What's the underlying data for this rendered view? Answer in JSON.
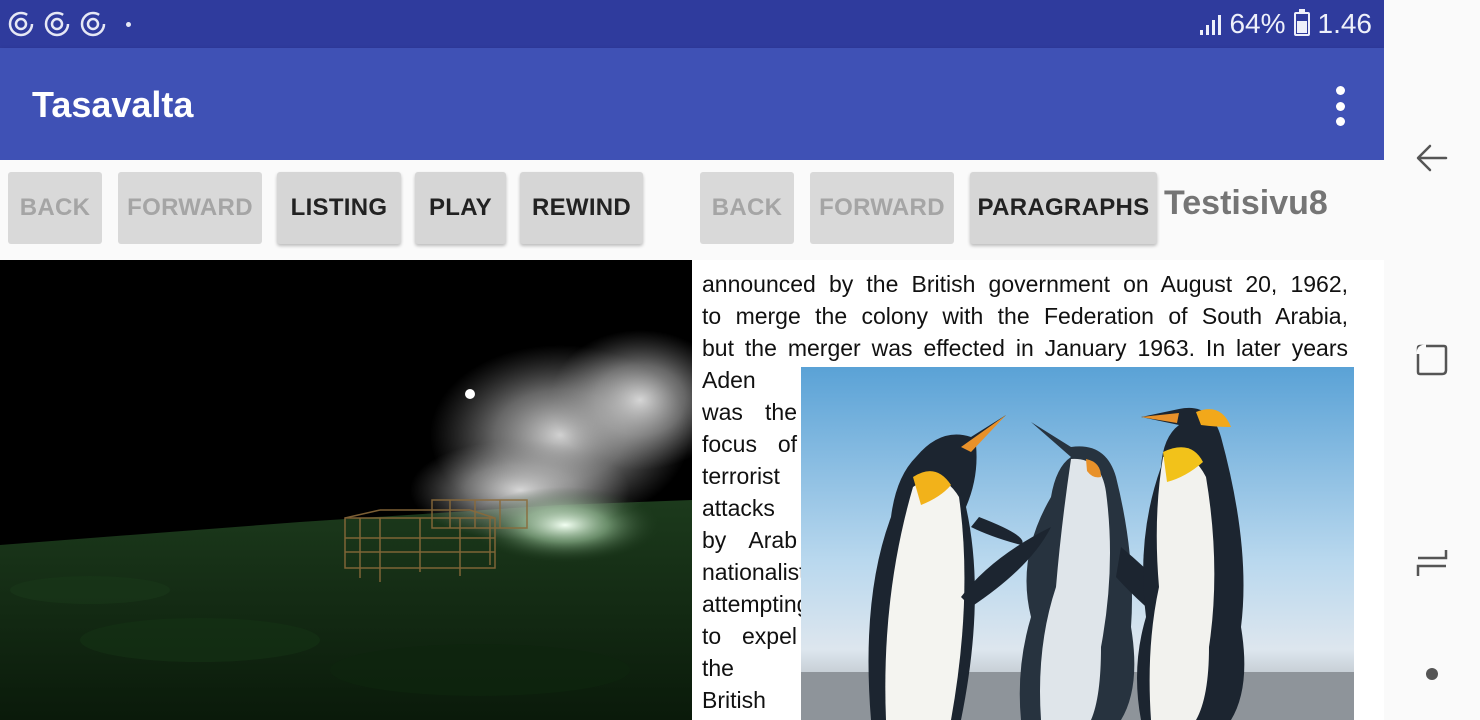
{
  "status_bar": {
    "notification_icons": [
      "sync-icon",
      "sync-icon",
      "sync-icon",
      "dot-icon"
    ],
    "battery_percent": "64%",
    "time": "1.46",
    "signal_icon": "signal-icon",
    "battery_icon": "battery-charging-icon"
  },
  "app_bar": {
    "title": "Tasavalta",
    "menu_icon": "more-vert-icon"
  },
  "toolbar": {
    "left_back": "BACK",
    "left_forward": "FORWARD",
    "listing": "LISTING",
    "play": "PLAY",
    "rewind": "REWIND",
    "right_back": "BACK",
    "right_forward": "FORWARD",
    "paragraphs": "PARAGRAPHS",
    "page_title": "Testisivu8"
  },
  "article": {
    "lines": [
      "announced by the British government on August 20, 1962,",
      "to merge the colony with the Federation of South Arabia,",
      "but the merger was effected in January 1963. In later years"
    ],
    "side_text": [
      "Aden",
      "was the",
      "focus of",
      "terrorist",
      "attacks",
      "by Arab",
      "nationalists",
      "attempting",
      "to expel",
      "the",
      "British"
    ]
  },
  "colors": {
    "status_bar": "#2f3b9d",
    "app_bar": "#3f51b5",
    "button": "#d6d6d6",
    "disabled_text": "#a5a5a5"
  },
  "nav_bar": {
    "icons": [
      "back-arrow-icon",
      "recents-icon",
      "overview-icon",
      "home-dot-icon"
    ]
  }
}
